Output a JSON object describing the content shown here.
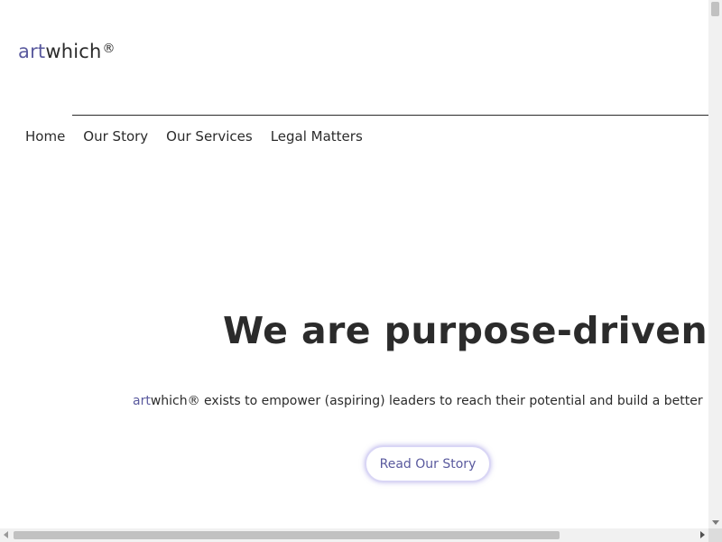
{
  "brand": {
    "name_accent": "art",
    "name_rest": "which",
    "registered": "®",
    "accent_color": "#5a5a9e"
  },
  "nav": {
    "items": [
      {
        "label": "Home"
      },
      {
        "label": "Our Story"
      },
      {
        "label": "Our Services"
      },
      {
        "label": "Legal Matters"
      }
    ]
  },
  "hero": {
    "headline": "We are purpose-driven.",
    "tagline_accent": "art",
    "tagline_rest": "which® exists to empower (aspiring) leaders to reach their potential and build a better",
    "cta_label": "Read Our Story"
  },
  "icons": {
    "scroll_down": "arrow-down-icon",
    "scroll_left": "arrow-left-icon",
    "scroll_right": "arrow-right-icon"
  }
}
